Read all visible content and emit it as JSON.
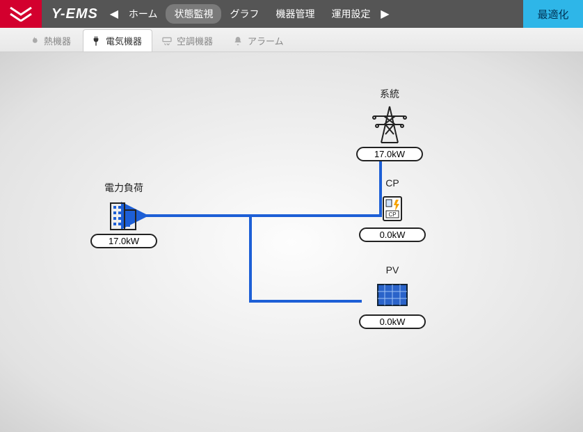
{
  "header": {
    "brand": "Y-EMS",
    "nav": {
      "home": "ホーム",
      "monitor": "状態監視",
      "graph": "グラフ",
      "device_mgmt": "機器管理",
      "operation_set": "運用設定"
    },
    "optimize": "最適化"
  },
  "tabs": {
    "heat": "熱機器",
    "elec": "電気機器",
    "hvac": "空調機器",
    "alarm": "アラーム"
  },
  "nodes": {
    "load": {
      "label": "電力負荷",
      "value": "17.0kW"
    },
    "grid": {
      "label": "系統",
      "value": "17.0kW"
    },
    "cp": {
      "label": "CP",
      "value": "0.0kW"
    },
    "pv": {
      "label": "PV",
      "value": "0.0kW"
    }
  },
  "colors": {
    "flow": "#1d5fd6",
    "accent_red": "#d3002e",
    "opt_btn": "#2eb6e8"
  }
}
